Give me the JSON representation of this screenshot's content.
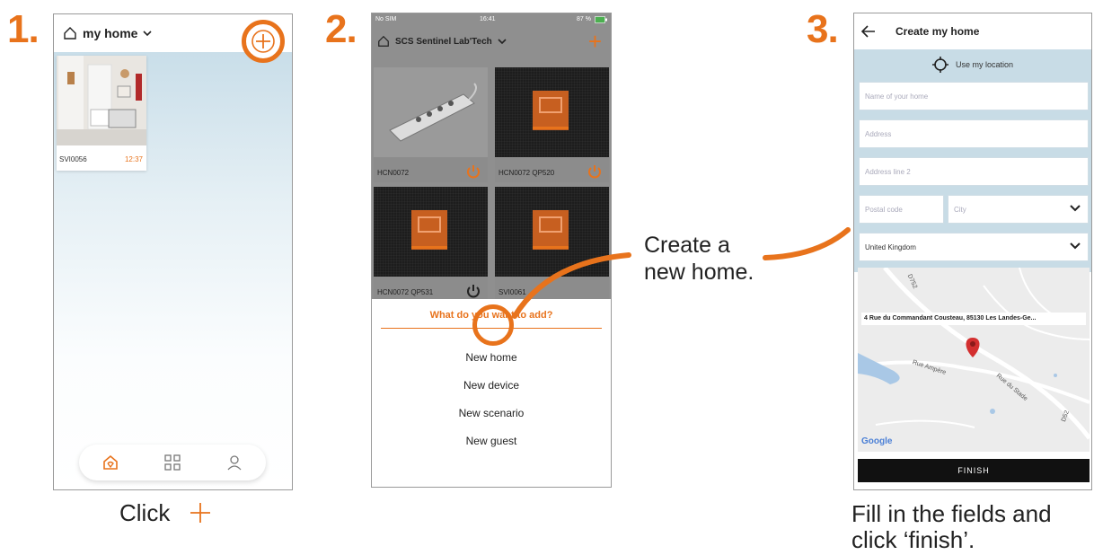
{
  "steps": [
    "1.",
    "2.",
    "3."
  ],
  "colors": {
    "accent": "#e8731c",
    "finish_bg": "#111111",
    "form_bg": "#c8dce6"
  },
  "phone1": {
    "home_name": "my home",
    "camera": {
      "label": "SVI0056",
      "time": "12:37"
    },
    "add_icon": "plus-circle-icon",
    "tabs": [
      "home-icon",
      "grid-icon",
      "profile-icon"
    ]
  },
  "caption1": {
    "text": "Click",
    "icon": "plus-icon"
  },
  "phone2": {
    "status": {
      "carrier": "No SIM",
      "time": "16:41",
      "battery": "87 %"
    },
    "home_name": "SCS Sentinel Lab'Tech",
    "devices": [
      {
        "label": "HCN0072"
      },
      {
        "label": "HCN0072 QP520"
      },
      {
        "label": "HCN0072 QP531"
      },
      {
        "label": "SVI0061"
      }
    ],
    "sheet_title": "What do you want to add?",
    "options": [
      "New home",
      "New device",
      "New scenario",
      "New guest"
    ]
  },
  "callout": {
    "line1": "Create a",
    "line2": "new home."
  },
  "phone3": {
    "title": "Create my home",
    "use_location": "Use my location",
    "fields": {
      "name": "Name of your home",
      "address": "Address",
      "address2": "Address line 2",
      "postal": "Postal code",
      "city": "City",
      "country": "United Kingdom"
    },
    "map_address": "4 Rue du Commandant Cousteau, 85130 Les Landes-Ge...",
    "map_roads": [
      "D752",
      "Rue Ampère",
      "Rue du Stade",
      "D52"
    ],
    "google": "Google",
    "finish": "FINISH"
  },
  "caption3": {
    "line1": "Fill in the fields and",
    "line2": "click ‘finish’."
  }
}
